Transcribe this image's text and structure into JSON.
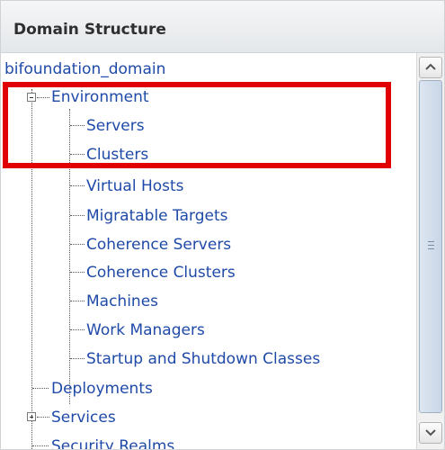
{
  "header": {
    "title": "Domain Structure"
  },
  "tree": {
    "root": "bifoundation_domain",
    "environment": {
      "label": "Environment",
      "children": [
        "Servers",
        "Clusters",
        "Virtual Hosts",
        "Migratable Targets",
        "Coherence Servers",
        "Coherence Clusters",
        "Machines",
        "Work Managers",
        "Startup and Shutdown Classes"
      ]
    },
    "deployments": "Deployments",
    "services": "Services",
    "security_realms": "Security Realms"
  },
  "colors": {
    "link": "#1f4aa8",
    "highlight": "#e00000"
  }
}
